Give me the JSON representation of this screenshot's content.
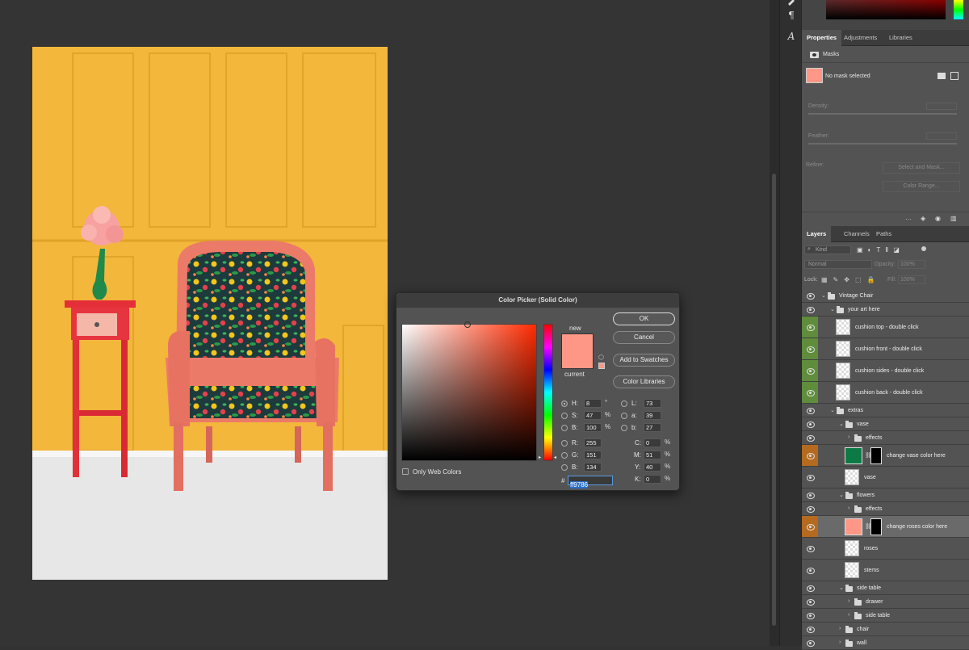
{
  "colors": {
    "wall": "#f4b73a",
    "floor": "#e6e6e6",
    "chair_wood": "#ef7c6b",
    "side_table": "#e8303a",
    "vase": "#1f8a4a",
    "new_color": "#ff9786",
    "layer_green": "#5f8d3c",
    "layer_orange": "#b56a1f"
  },
  "tool_icons": [
    "brush-icon",
    "paragraph-icon",
    "character-icon"
  ],
  "tools": {
    "paragraph": "¶",
    "character": "A"
  },
  "properties": {
    "tabs": [
      "Properties",
      "Adjustments",
      "Libraries"
    ],
    "section": "Masks",
    "mask_status": "No mask selected",
    "density_label": "Density:",
    "feather_label": "Feather:",
    "refine_label": "Refine:",
    "select_and_mask": "Select and Mask...",
    "color_range": "Color Range..."
  },
  "layers_panel": {
    "tabs": [
      "Layers",
      "Channels",
      "Paths"
    ],
    "filter_kind": "Kind",
    "blend_mode": "Normal",
    "opacity_label": "Opacity:",
    "opacity_value": "100%",
    "lock_label": "Lock:",
    "fill_label": "Fill:",
    "fill_value": "100%",
    "layers": [
      {
        "name": "Vintage Chair",
        "type": "group",
        "indent": 0
      },
      {
        "name": "your art here",
        "type": "group",
        "indent": 1
      },
      {
        "name": "cushion top - double click",
        "type": "smart",
        "indent": 2,
        "highlight": "green"
      },
      {
        "name": "cushion front - double click",
        "type": "smart",
        "indent": 2,
        "highlight": "green"
      },
      {
        "name": "cushion sides - double click",
        "type": "smart",
        "indent": 2,
        "highlight": "green"
      },
      {
        "name": "cushion back - double click",
        "type": "smart",
        "indent": 2,
        "highlight": "green"
      },
      {
        "name": "extras",
        "type": "group",
        "indent": 1
      },
      {
        "name": "vase",
        "type": "group",
        "indent": 2
      },
      {
        "name": "effects",
        "type": "group",
        "indent": 3,
        "collapsed": true
      },
      {
        "name": "change vase color here",
        "type": "fill",
        "indent": 3,
        "highlight": "orange",
        "swatch": "#0d7a45"
      },
      {
        "name": "vase",
        "type": "pixel",
        "indent": 3
      },
      {
        "name": "flowers",
        "type": "group",
        "indent": 2
      },
      {
        "name": "effects",
        "type": "group",
        "indent": 3,
        "collapsed": true
      },
      {
        "name": "change roses color here",
        "type": "fill",
        "indent": 3,
        "highlight": "orange",
        "swatch": "#ff9786",
        "selected": true
      },
      {
        "name": "roses",
        "type": "pixel",
        "indent": 3
      },
      {
        "name": "stems",
        "type": "pixel",
        "indent": 3
      },
      {
        "name": "side table",
        "type": "group",
        "indent": 2
      },
      {
        "name": "drawer",
        "type": "group",
        "indent": 3,
        "collapsed": true
      },
      {
        "name": "side table",
        "type": "group",
        "indent": 3,
        "collapsed": true
      },
      {
        "name": "chair",
        "type": "group",
        "indent": 2,
        "collapsed": true
      },
      {
        "name": "wall",
        "type": "group",
        "indent": 2,
        "collapsed": true
      }
    ]
  },
  "color_picker": {
    "title": "Color Picker (Solid Color)",
    "ok": "OK",
    "cancel": "Cancel",
    "add_to_swatches": "Add to Swatches",
    "color_libraries": "Color Libraries",
    "new_label": "new",
    "current_label": "current",
    "only_web_colors": "Only Web Colors",
    "fields": {
      "H": {
        "label": "H:",
        "value": "8",
        "unit": "°"
      },
      "S": {
        "label": "S:",
        "value": "47",
        "unit": "%"
      },
      "B": {
        "label": "B:",
        "value": "100",
        "unit": "%"
      },
      "R": {
        "label": "R:",
        "value": "255",
        "unit": ""
      },
      "G": {
        "label": "G:",
        "value": "151",
        "unit": ""
      },
      "Bl": {
        "label": "B:",
        "value": "134",
        "unit": ""
      },
      "L": {
        "label": "L:",
        "value": "73",
        "unit": ""
      },
      "a": {
        "label": "a:",
        "value": "39",
        "unit": ""
      },
      "b": {
        "label": "b:",
        "value": "27",
        "unit": ""
      },
      "C": {
        "label": "C:",
        "value": "0",
        "unit": "%"
      },
      "M": {
        "label": "M:",
        "value": "51",
        "unit": "%"
      },
      "Y": {
        "label": "Y:",
        "value": "40",
        "unit": "%"
      },
      "K": {
        "label": "K:",
        "value": "0",
        "unit": "%"
      }
    },
    "hash": "#",
    "hex": "ff9786"
  }
}
